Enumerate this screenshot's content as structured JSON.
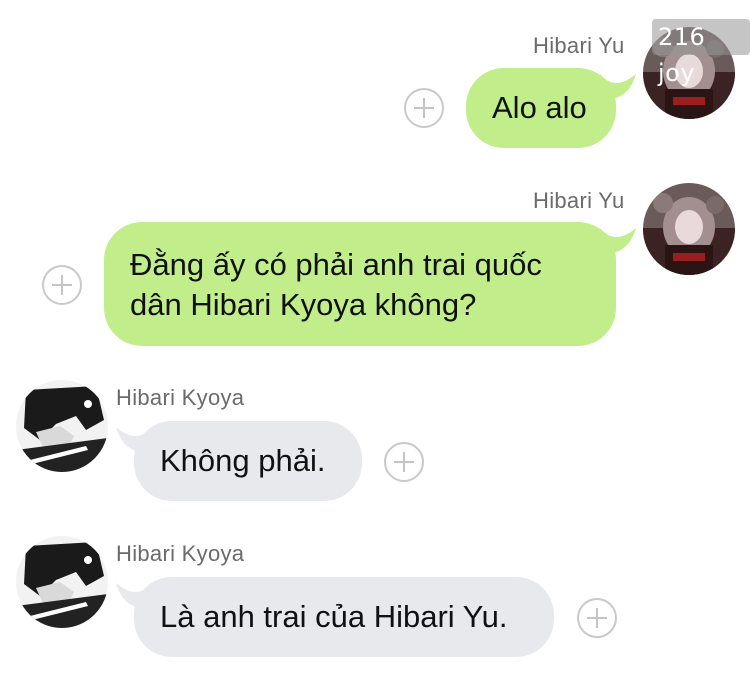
{
  "watermark": "216 joy",
  "messages": [
    {
      "sender": "Hibari Yu",
      "text": "Alo alo",
      "side": "right"
    },
    {
      "sender": "Hibari Yu",
      "line1": "Đằng ấy có phải anh trai  quốc",
      "line2": "dân Hibari Kyoya không?",
      "side": "right"
    },
    {
      "sender": "Hibari Kyoya",
      "text": "Không phải.",
      "side": "left"
    },
    {
      "sender": "Hibari Kyoya",
      "text": "Là anh trai của Hibari Yu.",
      "side": "left"
    }
  ],
  "colors": {
    "outgoing_bubble": "#c1ee8b",
    "incoming_bubble": "#e8e9ed",
    "sender_name": "#6b6b6b"
  },
  "icons": {
    "reaction": "plus-circle-icon"
  }
}
